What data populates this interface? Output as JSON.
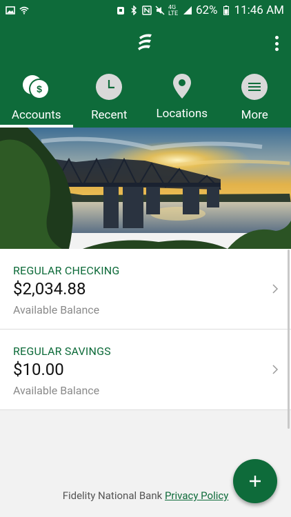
{
  "status": {
    "battery": "62%",
    "time": "11:46 AM",
    "network": "4G LTE"
  },
  "tabs": [
    {
      "label": "Accounts",
      "icon": "accounts-icon",
      "active": true
    },
    {
      "label": "Recent",
      "icon": "clock-icon",
      "active": false
    },
    {
      "label": "Locations",
      "icon": "location-pin-icon",
      "active": false
    },
    {
      "label": "More",
      "icon": "menu-icon",
      "active": false
    }
  ],
  "accounts": [
    {
      "name": "REGULAR CHECKING",
      "amount": "$2,034.88",
      "sub": "Available Balance"
    },
    {
      "name": "REGULAR SAVINGS",
      "amount": "$10.00",
      "sub": "Available Balance"
    }
  ],
  "footer": {
    "bank": "Fidelity National Bank",
    "privacy": "Privacy Policy"
  },
  "colors": {
    "brand_green": "#0e6b3a",
    "background": "#f2f2f2"
  }
}
